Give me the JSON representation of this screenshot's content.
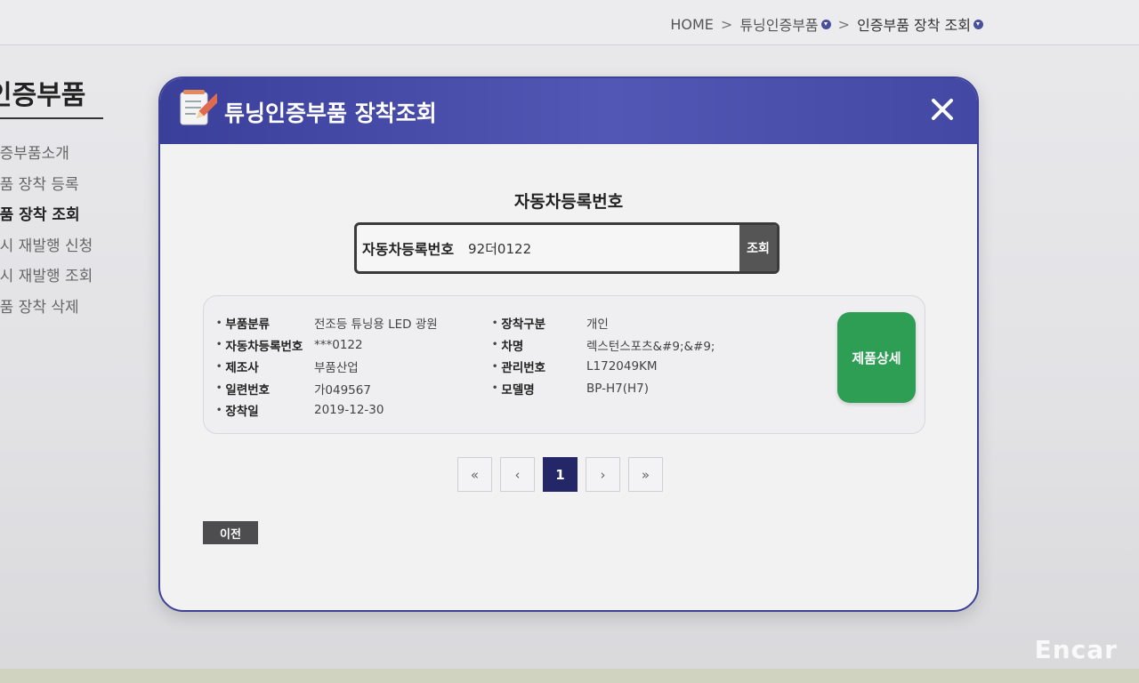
{
  "breadcrumb": {
    "home": "HOME",
    "level1": "튜닝인증부품",
    "level2": "인증부품 장착 조회"
  },
  "sidebar": {
    "title": "인증부품",
    "items": [
      {
        "label": "인증부품소개"
      },
      {
        "label": "부품 장착 등록"
      },
      {
        "label": "부품 장착 조회"
      },
      {
        "label": "표시 재발행 신청"
      },
      {
        "label": "표시 재발행 조회"
      },
      {
        "label": "부품 장착 삭제"
      }
    ]
  },
  "modal": {
    "title": "튜닝인증부품 장착조회",
    "search_heading": "자동차등록번호",
    "search_label": "자동차등록번호",
    "search_value": "92더0122",
    "search_button": "조회",
    "details_left": [
      {
        "key": "부품분류",
        "value": "전조등 튜닝용 LED 광원"
      },
      {
        "key": "자동차등록번호",
        "value": "***0122"
      },
      {
        "key": "제조사",
        "value": "부품산업"
      },
      {
        "key": "일련번호",
        "value": "가049567"
      },
      {
        "key": "장착일",
        "value": "2019-12-30"
      }
    ],
    "details_right": [
      {
        "key": "장착구분",
        "value": "개인"
      },
      {
        "key": "차명",
        "value": "렉스턴스포츠&#9;&#9;"
      },
      {
        "key": "관리번호",
        "value": "L172049KM"
      },
      {
        "key": "모델명",
        "value": "BP-H7(H7)"
      }
    ],
    "detail_button": "제품상세",
    "pagination": {
      "first": "«",
      "prev": "‹",
      "current": "1",
      "next": "›",
      "last": "»"
    },
    "prev_button": "이전"
  },
  "watermark": "Encar",
  "colors": {
    "header": "#3d4296",
    "detail_button": "#2f9e55",
    "active_page": "#232768"
  }
}
